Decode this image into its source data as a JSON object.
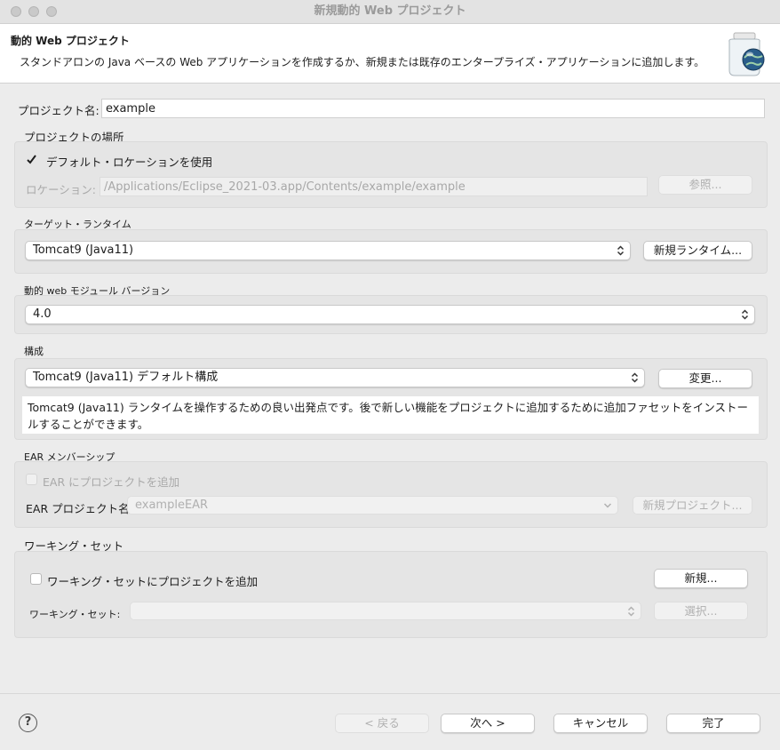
{
  "window": {
    "title": "新規動的 Web プロジェクト"
  },
  "header": {
    "title": "動的 Web プロジェクト",
    "description": "スタンドアロンの Java ベースの Web アプリケーションを作成するか、新規または既存のエンタープライズ・アプリケーションに追加します。",
    "icon": "web-project-jar-globe-icon"
  },
  "project_name": {
    "label": "プロジェクト名:",
    "value": "example"
  },
  "location": {
    "group_label": "プロジェクトの場所",
    "use_default_label": "デフォルト・ロケーションを使用",
    "use_default_checked": true,
    "location_label": "ロケーション:",
    "location_value": "/Applications/Eclipse_2021-03.app/Contents/example/example",
    "browse_label": "参照..."
  },
  "target_runtime": {
    "group_label": "ターゲット・ランタイム",
    "selected": "Tomcat9 (Java11)",
    "new_runtime_label": "新規ランタイム..."
  },
  "module_version": {
    "group_label": "動的 web モジュール バージョン",
    "selected": "4.0"
  },
  "configuration": {
    "group_label": "構成",
    "selected": "Tomcat9 (Java11) デフォルト構成",
    "modify_label": "変更...",
    "description": "Tomcat9 (Java11) ランタイムを操作するための良い出発点です。後で新しい機能をプロジェクトに追加するために追加ファセットをインストールすることができます。"
  },
  "ear": {
    "group_label": "EAR メンバーシップ",
    "add_label": "EAR にプロジェクトを追加",
    "add_checked": false,
    "project_label": "EAR プロジェクト名:",
    "project_value": "exampleEAR",
    "new_project_label": "新規プロジェクト..."
  },
  "working_set": {
    "group_label": "ワーキング・セット",
    "add_label": "ワーキング・セットにプロジェクトを追加",
    "add_checked": false,
    "new_label": "新規...",
    "sets_label": "ワーキング・セット:",
    "sets_value": "",
    "select_label": "選択..."
  },
  "footer": {
    "help_label": "?",
    "back_label": "< 戻る",
    "next_label": "次へ >",
    "cancel_label": "キャンセル",
    "finish_label": "完了"
  },
  "colors": {
    "background": "#ececec",
    "header_bg": "#ffffff",
    "group_bg": "#e5e5e5",
    "disabled_text": "#a9a9a9"
  }
}
